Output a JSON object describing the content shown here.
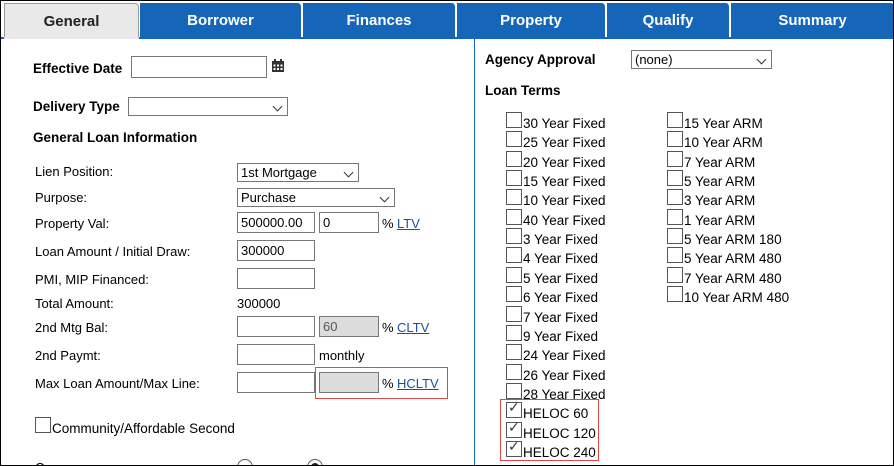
{
  "tabs": [
    {
      "label": "General",
      "active": true
    },
    {
      "label": "Borrower"
    },
    {
      "label": "Finances"
    },
    {
      "label": "Property"
    },
    {
      "label": "Qualify"
    },
    {
      "label": "Summary"
    }
  ],
  "left": {
    "effective_date_label": "Effective Date",
    "effective_date_value": "",
    "delivery_type_label": "Delivery Type",
    "delivery_type_value": "",
    "section_title": "General Loan Information",
    "lien_position_label": "Lien Position:",
    "lien_position_value": "1st Mortgage",
    "purpose_label": "Purpose:",
    "purpose_value": "Purchase",
    "property_val_label": "Property Val:",
    "property_val_value": "500000.00",
    "property_pct_value": "0",
    "pct_symbol": "%",
    "ltv_link": "LTV",
    "loan_amount_label": "Loan Amount / Initial Draw:",
    "loan_amount_value": "300000",
    "pmi_label": "PMI, MIP Financed:",
    "pmi_value": "",
    "total_amount_label": "Total Amount:",
    "total_amount_value": "300000",
    "second_mtg_label": "2nd Mtg Bal:",
    "second_mtg_value": "",
    "cltv_value": "60",
    "cltv_link": "CLTV",
    "second_paymt_label": "2nd Paymt:",
    "second_paymt_value": "",
    "monthly_label": "monthly",
    "max_loan_label": "Max Loan Amount/Max Line:",
    "max_loan_value": "",
    "hcltv_value": "",
    "hcltv_link": "HCLTV",
    "community_label": "Community/Affordable Second",
    "cut_label": "C"
  },
  "right": {
    "agency_approval_label": "Agency Approval",
    "agency_approval_value": "(none)",
    "loan_terms_label": "Loan Terms",
    "col1": [
      {
        "label": "30 Year Fixed",
        "checked": false
      },
      {
        "label": "25 Year Fixed",
        "checked": false
      },
      {
        "label": "20 Year Fixed",
        "checked": false
      },
      {
        "label": "15 Year Fixed",
        "checked": false
      },
      {
        "label": "10 Year Fixed",
        "checked": false
      },
      {
        "label": "40 Year Fixed",
        "checked": false
      },
      {
        "label": "3 Year Fixed",
        "checked": false
      },
      {
        "label": "4 Year Fixed",
        "checked": false
      },
      {
        "label": "5 Year Fixed",
        "checked": false
      },
      {
        "label": "6 Year Fixed",
        "checked": false
      },
      {
        "label": "7 Year Fixed",
        "checked": false
      },
      {
        "label": "9 Year Fixed",
        "checked": false
      },
      {
        "label": "24 Year Fixed",
        "checked": false
      },
      {
        "label": "26 Year Fixed",
        "checked": false
      },
      {
        "label": "28 Year Fixed",
        "checked": false
      },
      {
        "label": "HELOC 60",
        "checked": true
      },
      {
        "label": "HELOC 120",
        "checked": true
      },
      {
        "label": "HELOC 240",
        "checked": true
      }
    ],
    "col2": [
      {
        "label": "15 Year ARM",
        "checked": false
      },
      {
        "label": "10 Year ARM",
        "checked": false
      },
      {
        "label": "7 Year ARM",
        "checked": false
      },
      {
        "label": "5 Year ARM",
        "checked": false
      },
      {
        "label": "3 Year ARM",
        "checked": false
      },
      {
        "label": "1 Year ARM",
        "checked": false
      },
      {
        "label": "5 Year ARM 180",
        "checked": false
      },
      {
        "label": "5 Year ARM 480",
        "checked": false
      },
      {
        "label": "7 Year ARM 480",
        "checked": false
      },
      {
        "label": "10 Year ARM 480",
        "checked": false
      }
    ]
  },
  "colors": {
    "tab_blue": "#1565b8",
    "highlight_red": "#e04848",
    "link": "#1a4f9c"
  }
}
